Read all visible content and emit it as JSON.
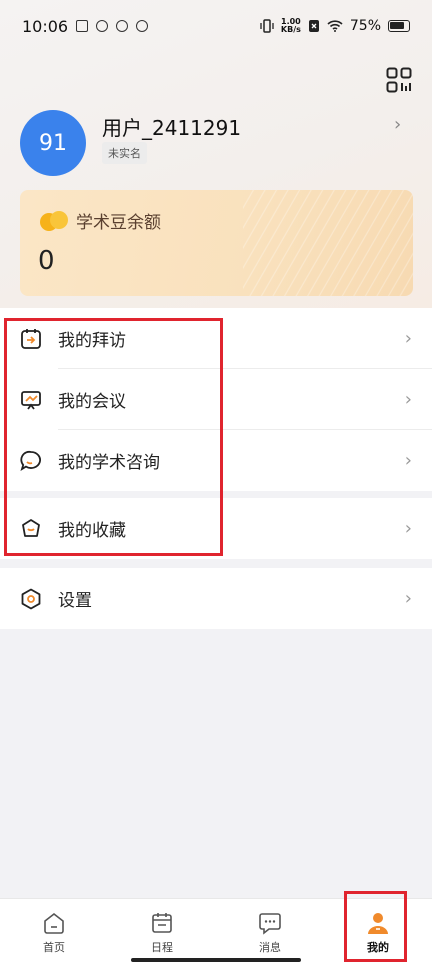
{
  "status_bar": {
    "time": "10:06",
    "net_speed_value": "1.00",
    "net_speed_unit": "KB/s",
    "battery": "75%"
  },
  "profile": {
    "avatar_text": "91",
    "username": "用户_2411291",
    "verification": "未实名",
    "chevron": "›"
  },
  "points": {
    "title": "学术豆余额",
    "value": "0"
  },
  "menu_group_1": [
    {
      "label": "我的拜访",
      "icon": "visit-icon"
    },
    {
      "label": "我的会议",
      "icon": "meeting-icon"
    },
    {
      "label": "我的学术咨询",
      "icon": "consult-icon"
    }
  ],
  "menu_group_2": [
    {
      "label": "我的收藏",
      "icon": "favorite-icon"
    }
  ],
  "menu_group_3": [
    {
      "label": "设置",
      "icon": "settings-icon"
    }
  ],
  "chevron": "›",
  "tabs": [
    {
      "label": "首页",
      "icon": "home-icon"
    },
    {
      "label": "日程",
      "icon": "calendar-icon"
    },
    {
      "label": "消息",
      "icon": "message-icon"
    },
    {
      "label": "我的",
      "icon": "profile-icon",
      "active": true
    }
  ],
  "colors": {
    "accent": "#f08a2c",
    "avatar": "#3a82ec",
    "highlight": "#e0242e"
  }
}
